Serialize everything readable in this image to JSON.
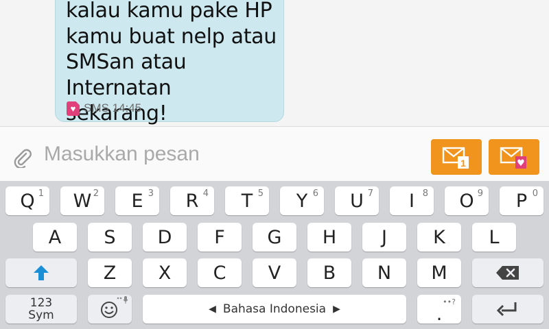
{
  "message": {
    "lines": [
      "kalau kamu pake HP",
      "kamu buat nelp atau",
      "SMSan atau",
      "Internatan sekarang!"
    ],
    "type": "SMS",
    "time": "14:45"
  },
  "compose": {
    "placeholder": "Masukkan pesan",
    "send_sim1_badge": "1"
  },
  "keyboard": {
    "row1": [
      {
        "key": "Q",
        "num": "1"
      },
      {
        "key": "W",
        "num": "2"
      },
      {
        "key": "E",
        "num": "3"
      },
      {
        "key": "R",
        "num": "4"
      },
      {
        "key": "T",
        "num": "5"
      },
      {
        "key": "Y",
        "num": "6"
      },
      {
        "key": "U",
        "num": "7"
      },
      {
        "key": "I",
        "num": "8"
      },
      {
        "key": "O",
        "num": "9"
      },
      {
        "key": "P",
        "num": "0"
      }
    ],
    "row2": [
      "A",
      "S",
      "D",
      "F",
      "G",
      "H",
      "J",
      "K",
      "L"
    ],
    "row3": [
      "Z",
      "X",
      "C",
      "V",
      "B",
      "N",
      "M"
    ],
    "sym_line1": "123",
    "sym_line2": "Sym",
    "space_label": "Bahasa Indonesia",
    "period": ".",
    "period_alt": "••?"
  },
  "colors": {
    "accent": "#f0941e",
    "bubble": "#cde9ef",
    "sim_badge": "#e0407a",
    "shift_arrow": "#1a8fd6"
  }
}
